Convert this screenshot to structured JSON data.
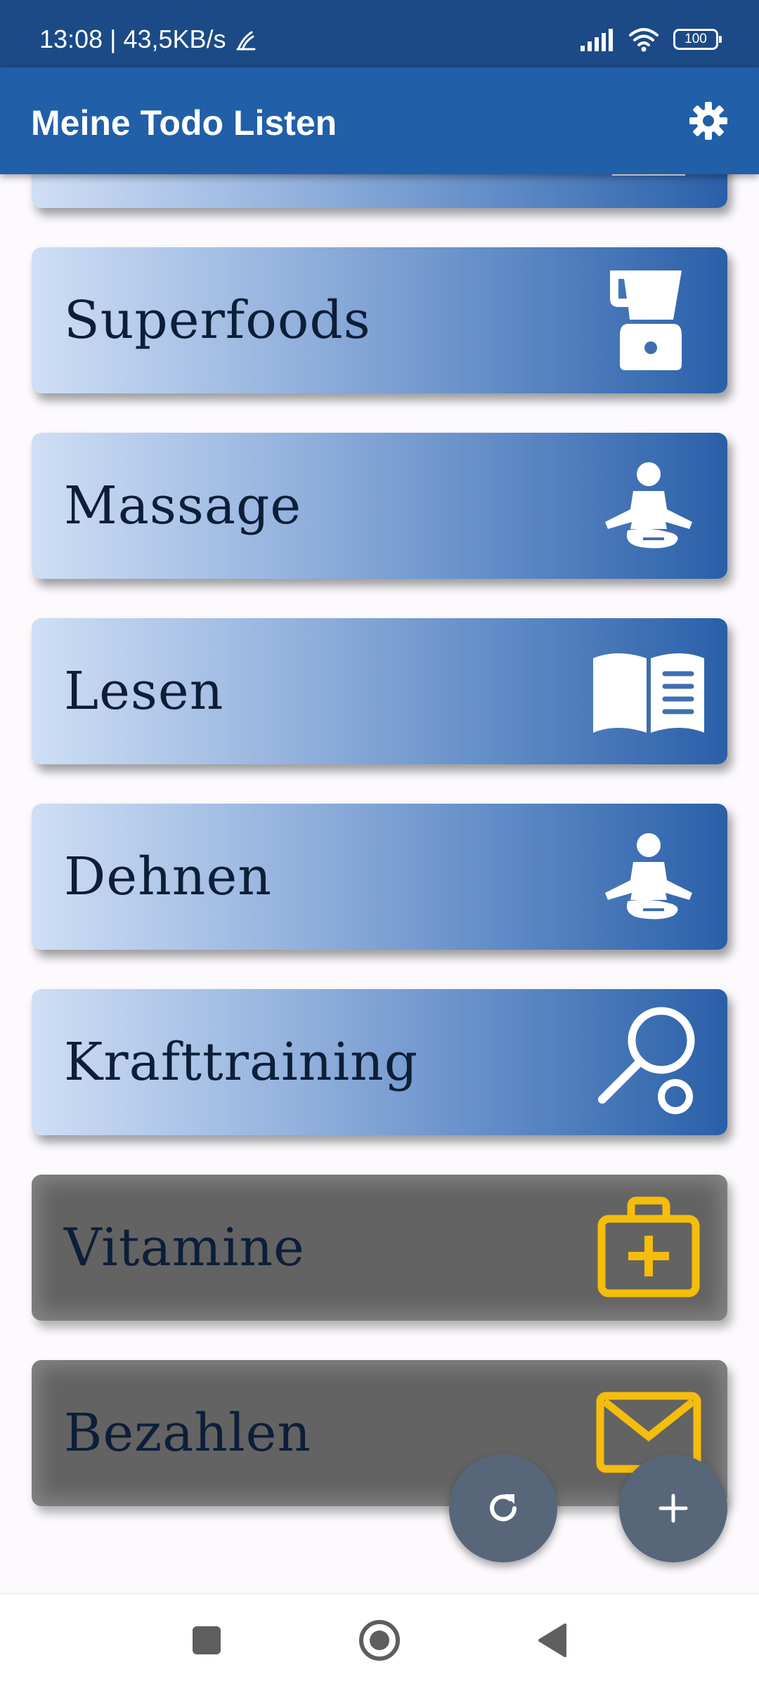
{
  "status_bar": {
    "time_speed": "13:08 | 43,5KB/s",
    "battery": "100"
  },
  "app_bar": {
    "title": "Meine Todo Listen",
    "settings_icon": "gear-icon"
  },
  "lists": [
    {
      "label": "",
      "icon": "book-icon",
      "style": "blue"
    },
    {
      "label": "Superfoods",
      "icon": "blender-icon",
      "style": "blue"
    },
    {
      "label": "Massage",
      "icon": "meditation-icon",
      "style": "blue"
    },
    {
      "label": "Lesen",
      "icon": "open-book-icon",
      "style": "blue"
    },
    {
      "label": "Dehnen",
      "icon": "meditation-icon",
      "style": "blue"
    },
    {
      "label": "Krafttraining",
      "icon": "racket-ball-icon",
      "style": "blue"
    },
    {
      "label": "Vitamine",
      "icon": "first-aid-kit-icon",
      "style": "gray"
    },
    {
      "label": "Bezahlen",
      "icon": "envelope-icon",
      "style": "gray"
    }
  ],
  "fab": {
    "refresh_icon": "refresh-icon",
    "add_icon": "plus-icon"
  },
  "nav_bar": {
    "recents_icon": "square-icon",
    "home_icon": "home-circle-icon",
    "back_icon": "back-triangle-icon"
  },
  "colors": {
    "app_bar": "#215fa8",
    "status_bar": "#1c4a86",
    "card_gradient_start": "#cfdff5",
    "card_gradient_end": "#2a5fa8",
    "disabled_card": "#636363",
    "accent_icon": "#f5bd0c",
    "fab": "#58667a"
  }
}
